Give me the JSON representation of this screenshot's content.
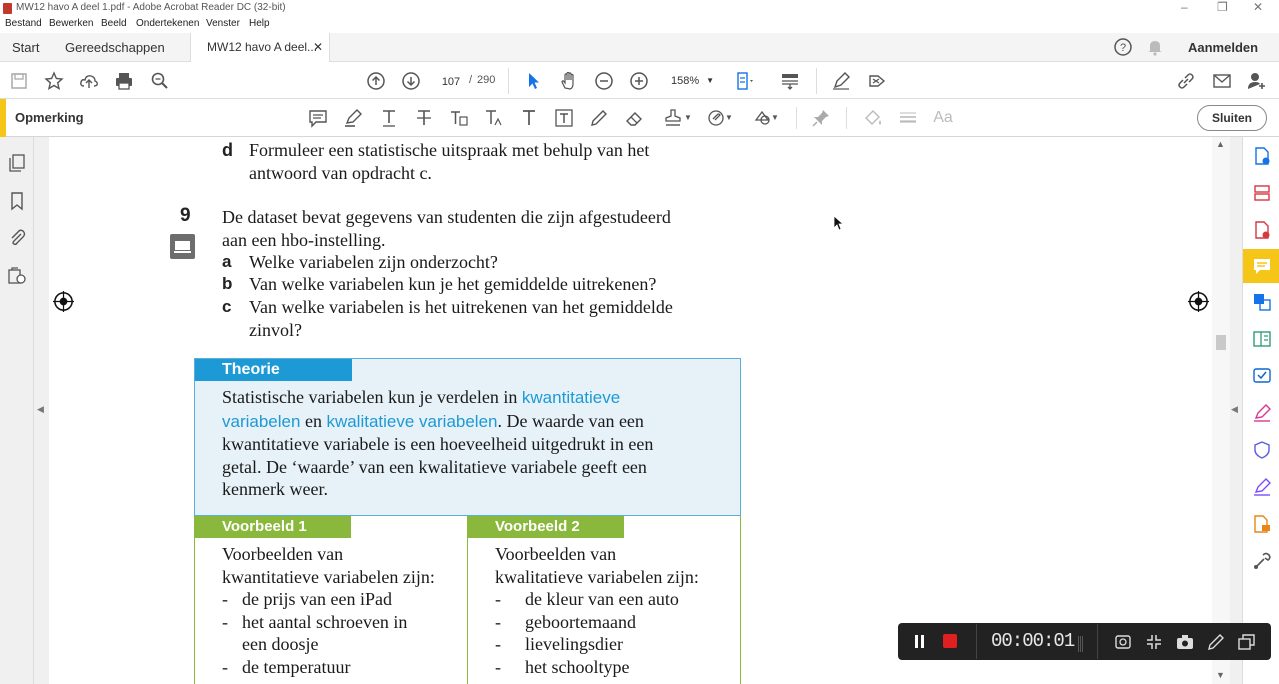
{
  "window": {
    "title": "MW12 havo A deel 1.pdf - Adobe Acrobat Reader DC (32-bit)"
  },
  "menu": [
    "Bestand",
    "Bewerken",
    "Beeld",
    "Ondertekenen",
    "Venster",
    "Help"
  ],
  "tabs": {
    "start": "Start",
    "tools": "Gereedschappen",
    "doc": "MW12 havo A deel...",
    "signin": "Aanmelden"
  },
  "toolbar": {
    "page_current": "107",
    "page_sep": "/",
    "page_total": "290",
    "zoom": "158%"
  },
  "commentbar": {
    "label": "Opmerking",
    "close": "Sluiten"
  },
  "document": {
    "item_d_letter": "d",
    "item_d_lines": [
      "Formuleer een statistische uitspraak met behulp van het",
      "antwoord van opdracht c."
    ],
    "q9_number": "9",
    "q9_lines": [
      "De dataset bevat gegevens van studenten die zijn afgestudeerd",
      "aan een hbo-instelling."
    ],
    "q9_a_letter": "a",
    "q9_a": "Welke variabelen zijn onderzocht?",
    "q9_b_letter": "b",
    "q9_b": "Van welke variabelen kun je het gemiddelde uitrekenen?",
    "q9_c_letter": "c",
    "q9_c_lines": [
      "Van welke variabelen is het uitrekenen van het gemiddelde",
      "zinvol?"
    ],
    "theory": {
      "header": "Theorie",
      "l1_pre": "Statistische variabelen kun je verdelen in ",
      "l1_kw": "kwantitatieve",
      "l2_kw1": "variabelen",
      "l2_mid": " en ",
      "l2_kw2": "kwalitatieve variabelen",
      "l2_post": ". De waarde van een",
      "l3": "kwantitatieve variabele is een hoeveelheid uitgedrukt in een",
      "l4": "getal. De ‘waarde’ van een kwalitatieve variabele geeft een",
      "l5": "kenmerk weer."
    },
    "example1": {
      "header": "Voorbeeld 1",
      "intro": [
        "Voorbeelden van",
        "kwantitatieve variabelen zijn:"
      ],
      "dash": "-",
      "items": [
        "de prijs van een iPad",
        "het aantal schroeven in",
        "een doosje",
        "de temperatuur"
      ]
    },
    "example2": {
      "header": "Voorbeeld 2",
      "intro": [
        "Voorbeelden van",
        "kwalitatieve variabelen zijn:"
      ],
      "dash": "-",
      "items": [
        "de kleur van een auto",
        "geboortemaand",
        "lievelingsdier",
        "het schooltype"
      ]
    }
  },
  "recorder": {
    "time": "00:00:01"
  }
}
